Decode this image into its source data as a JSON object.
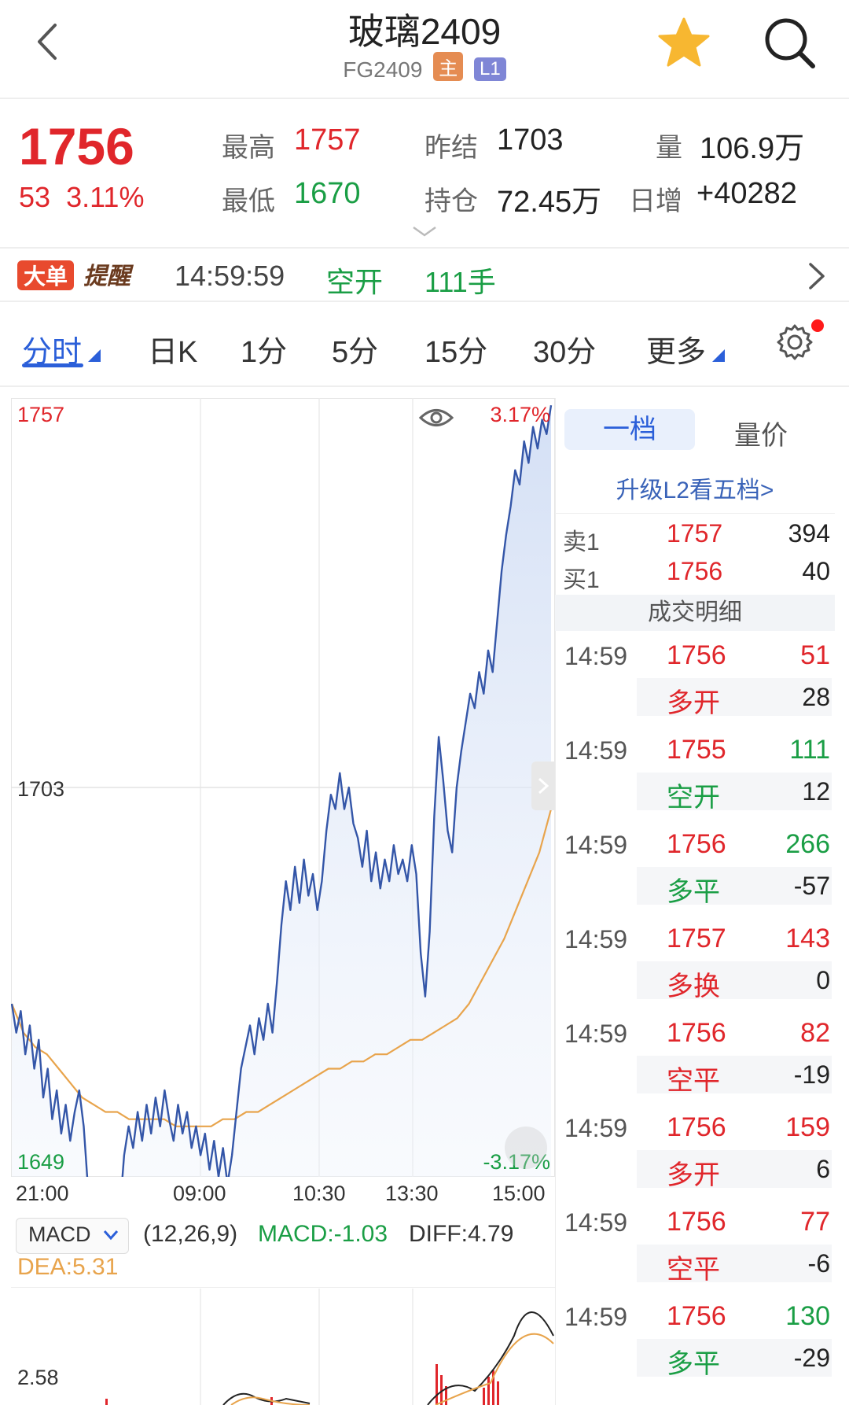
{
  "header": {
    "title": "玻璃2409",
    "code": "FG2409",
    "tag_main": "主",
    "tag_level": "L1"
  },
  "quote": {
    "price": "1756",
    "change": "53",
    "change_pct": "3.11%",
    "high_label": "最高",
    "high": "1757",
    "low_label": "最低",
    "low": "1670",
    "prev_close_label": "昨结",
    "prev_close": "1703",
    "open_interest_label": "持仓",
    "open_interest": "72.45万",
    "volume_label": "量",
    "volume": "106.9万",
    "daily_inc_label": "日增",
    "daily_inc": "+40282"
  },
  "alert": {
    "badge_a": "大单",
    "badge_b": "提醒",
    "time": "14:59:59",
    "type": "空开",
    "qty": "111手"
  },
  "tabs": [
    "分时",
    "日K",
    "1分",
    "5分",
    "15分",
    "30分",
    "更多"
  ],
  "chart": {
    "y_top": "1757",
    "y_mid": "1703",
    "y_bot": "1649",
    "pct_top": "3.17%",
    "pct_bot": "-3.17%",
    "times": [
      "21:00",
      "09:00",
      "10:30",
      "13:30",
      "15:00"
    ]
  },
  "chart_data": {
    "type": "line",
    "ylim": [
      1649,
      1757
    ],
    "reference": 1703,
    "series": [],
    "price_line": [
      1673,
      1669,
      1672,
      1666,
      1670,
      1664,
      1668,
      1660,
      1664,
      1657,
      1661,
      1655,
      1659,
      1654,
      1658,
      1661,
      1656,
      1647,
      1641,
      1645,
      1640,
      1646,
      1642,
      1648,
      1644,
      1652,
      1656,
      1653,
      1658,
      1654,
      1659,
      1655,
      1660,
      1656,
      1661,
      1657,
      1654,
      1659,
      1655,
      1658,
      1653,
      1656,
      1652,
      1655,
      1650,
      1654,
      1649,
      1653,
      1648,
      1652,
      1658,
      1664,
      1667,
      1670,
      1666,
      1671,
      1668,
      1673,
      1669,
      1676,
      1684,
      1690,
      1686,
      1692,
      1687,
      1693,
      1688,
      1691,
      1686,
      1690,
      1697,
      1702,
      1700,
      1705,
      1700,
      1703,
      1698,
      1696,
      1692,
      1697,
      1690,
      1694,
      1689,
      1693,
      1690,
      1695,
      1691,
      1693,
      1690,
      1695,
      1691,
      1680,
      1674,
      1683,
      1699,
      1710,
      1704,
      1697,
      1694,
      1703,
      1708,
      1712,
      1716,
      1714,
      1719,
      1716,
      1722,
      1719,
      1726,
      1733,
      1738,
      1742,
      1747,
      1745,
      1751,
      1748,
      1753,
      1750,
      1754,
      1752,
      1756
    ],
    "avg_line": [
      1673,
      1669,
      1667,
      1666,
      1664,
      1662,
      1660,
      1659,
      1658,
      1658,
      1657,
      1657,
      1657,
      1657,
      1656,
      1656,
      1656,
      1656,
      1657,
      1657,
      1658,
      1658,
      1659,
      1660,
      1661,
      1662,
      1663,
      1664,
      1664,
      1665,
      1665,
      1666,
      1666,
      1667,
      1668,
      1668,
      1669,
      1670,
      1671,
      1673,
      1676,
      1679,
      1682,
      1686,
      1690,
      1694,
      1700
    ],
    "macd": {
      "params": "(12,26,9)",
      "macd": -1.03,
      "diff": 4.79,
      "dea": 5.31,
      "y_label": "2.58"
    }
  },
  "macd": {
    "selector": "MACD",
    "params": "(12,26,9)",
    "macd_text": "MACD:-1.03",
    "diff_text": "DIFF:4.79",
    "dea_text": "DEA:5.31",
    "y_label": "2.58"
  },
  "orderbook": {
    "tab1": "一档",
    "tab2": "量价",
    "upgrade": "升级L2看五档>",
    "sell_label": "卖1",
    "sell_price": "1757",
    "sell_qty": "394",
    "buy_label": "买1",
    "buy_price": "1756",
    "buy_qty": "40",
    "detail_title": "成交明细"
  },
  "trades": [
    {
      "time": "14:59",
      "price": "1756",
      "vol": "51",
      "vol_color": "#e0262b",
      "type": "多开",
      "type_color": "#e0262b",
      "chg": "28"
    },
    {
      "time": "14:59",
      "price": "1755",
      "vol": "111",
      "vol_color": "#1a9e45",
      "type": "空开",
      "type_color": "#1a9e45",
      "chg": "12"
    },
    {
      "time": "14:59",
      "price": "1756",
      "vol": "266",
      "vol_color": "#1a9e45",
      "type": "多平",
      "type_color": "#1a9e45",
      "chg": "-57"
    },
    {
      "time": "14:59",
      "price": "1757",
      "vol": "143",
      "vol_color": "#e0262b",
      "type": "多换",
      "type_color": "#e0262b",
      "chg": "0"
    },
    {
      "time": "14:59",
      "price": "1756",
      "vol": "82",
      "vol_color": "#e0262b",
      "type": "空平",
      "type_color": "#e0262b",
      "chg": "-19"
    },
    {
      "time": "14:59",
      "price": "1756",
      "vol": "159",
      "vol_color": "#e0262b",
      "type": "多开",
      "type_color": "#e0262b",
      "chg": "6"
    },
    {
      "time": "14:59",
      "price": "1756",
      "vol": "77",
      "vol_color": "#e0262b",
      "type": "空平",
      "type_color": "#e0262b",
      "chg": "-6"
    },
    {
      "time": "14:59",
      "price": "1756",
      "vol": "130",
      "vol_color": "#1a9e45",
      "type": "多平",
      "type_color": "#1a9e45",
      "chg": "-29"
    }
  ],
  "colors": {
    "up": "#e0262b",
    "down": "#1a9e45",
    "accent": "#2b5fd9",
    "price_line": "#3456a8",
    "avg_line": "#e8a44c"
  },
  "icons": {
    "back": "chevron-left-icon",
    "favorite": "star-icon",
    "search": "search-icon",
    "settings": "gear-icon",
    "eye": "eye-icon"
  }
}
